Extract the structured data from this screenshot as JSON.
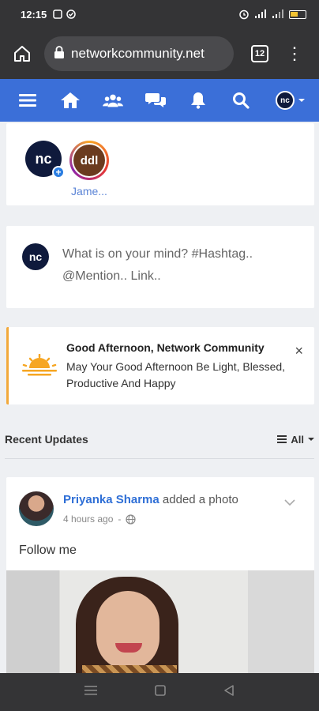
{
  "status_bar": {
    "time": "12:15"
  },
  "browser": {
    "url": "networkcommunity.net",
    "tab_count": "12"
  },
  "site_nav": {
    "avatar_initials": "nc"
  },
  "stories": [
    {
      "initials": "nc",
      "name": ""
    },
    {
      "initials": "ddl",
      "name": "Jame..."
    }
  ],
  "composer": {
    "avatar_initials": "nc",
    "placeholder": "What is on your mind? #Hashtag.. @Mention.. Link.."
  },
  "greeting": {
    "title": "Good Afternoon, Network Community",
    "body": "May Your Good Afternoon Be Light, Blessed, Productive And Happy",
    "close": "×"
  },
  "recent_updates": {
    "title": "Recent Updates",
    "filter_label": "All"
  },
  "post": {
    "author": "Priyanka Sharma",
    "action": "added a photo",
    "time": "4 hours ago",
    "separator": "-",
    "caption": "Follow me"
  },
  "colors": {
    "brand_blue": "#3b6fd8",
    "link_blue": "#2f6fd6",
    "greeting_accent": "#f2a93b",
    "browser_dark": "#343436"
  },
  "icons": [
    "home-icon",
    "lock-icon",
    "tabs-icon",
    "more-icon",
    "hamburger-icon",
    "house-icon",
    "groups-icon",
    "chat-icon",
    "bell-icon",
    "search-icon",
    "sunset-icon",
    "close-icon",
    "filter-icon",
    "chevron-down-icon",
    "globe-icon",
    "recent-apps-icon",
    "home-button-icon",
    "back-icon"
  ]
}
